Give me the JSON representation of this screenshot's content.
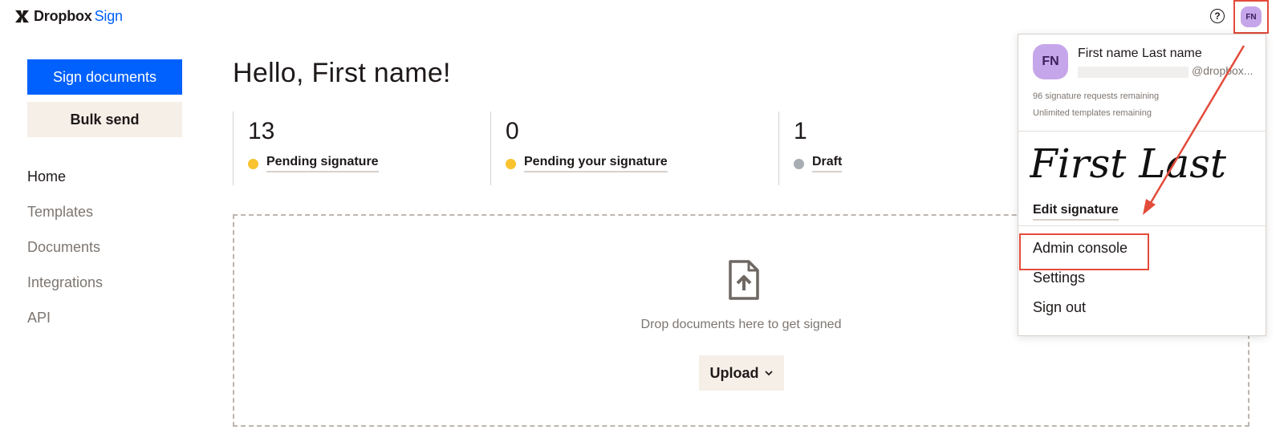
{
  "header": {
    "brand": "Dropbox",
    "product": "Sign",
    "help_glyph": "?",
    "avatar_initials": "FN"
  },
  "sidebar": {
    "primary_button": "Sign documents",
    "secondary_button": "Bulk send",
    "items": [
      {
        "label": "Home"
      },
      {
        "label": "Templates"
      },
      {
        "label": "Documents"
      },
      {
        "label": "Integrations"
      },
      {
        "label": "API"
      }
    ]
  },
  "main": {
    "greeting": "Hello, First name!",
    "stats": [
      {
        "count": "13",
        "label": "Pending signature",
        "color": "#f8c32e"
      },
      {
        "count": "0",
        "label": "Pending your signature",
        "color": "#f8c32e"
      },
      {
        "count": "1",
        "label": "Draft",
        "color": "#a8aeb4"
      }
    ],
    "drop_text": "Drop documents here to get signed",
    "upload_label": "Upload"
  },
  "account_menu": {
    "initials": "FN",
    "user_name": "First name Last name",
    "email": "@dropbox...",
    "signature_requests": "96 signature requests remaining",
    "templates": "Unlimited templates remaining",
    "signature_text": "First Last",
    "edit_signature": "Edit signature",
    "items": [
      {
        "label": "Admin console"
      },
      {
        "label": "Settings"
      },
      {
        "label": "Sign out"
      }
    ]
  },
  "colors": {
    "brand_blue": "#0061fe",
    "highlight_red": "#e34b3b",
    "avatar_purple": "#c6a6ea"
  }
}
